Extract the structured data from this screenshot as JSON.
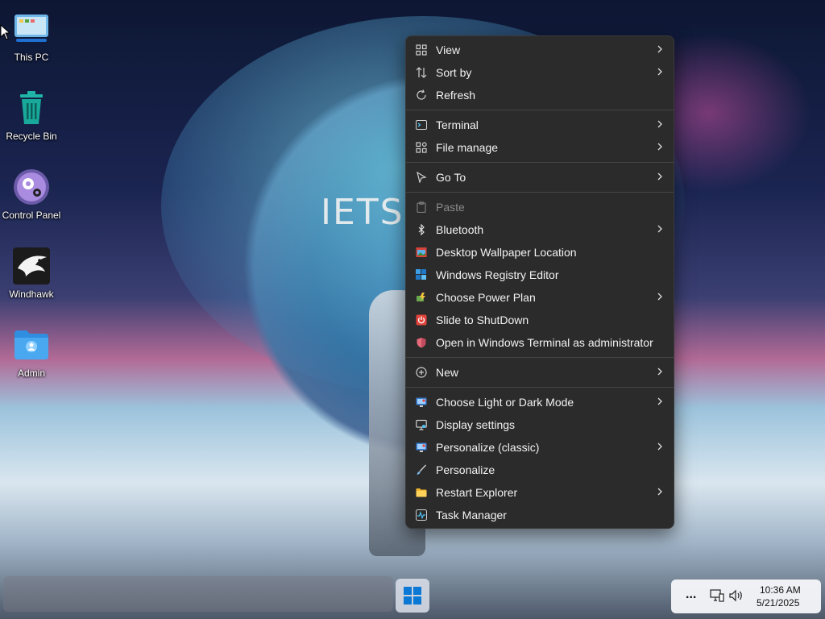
{
  "desktop": {
    "wallpaper_text": "IETS eX",
    "icons": [
      {
        "label": "This PC",
        "icon": "this-pc-icon"
      },
      {
        "label": "Recycle Bin",
        "icon": "recycle-bin-icon"
      },
      {
        "label": "Control Panel",
        "icon": "control-panel-icon"
      },
      {
        "label": "Windhawk",
        "icon": "windhawk-icon"
      },
      {
        "label": "Admin",
        "icon": "user-folder-icon"
      }
    ]
  },
  "context_menu": {
    "items": [
      {
        "label": "View",
        "icon": "grid-icon",
        "submenu": true
      },
      {
        "label": "Sort by",
        "icon": "sort-icon",
        "submenu": true
      },
      {
        "label": "Refresh",
        "icon": "refresh-icon",
        "submenu": false
      },
      {
        "label": "Terminal",
        "icon": "terminal-icon",
        "submenu": true
      },
      {
        "label": "File manage",
        "icon": "apps-icon",
        "submenu": true
      },
      {
        "label": "Go To",
        "icon": "pointer-icon",
        "submenu": true
      },
      {
        "label": "Paste",
        "icon": "clipboard-icon",
        "submenu": false,
        "disabled": true
      },
      {
        "label": "Bluetooth",
        "icon": "bluetooth-icon",
        "submenu": true
      },
      {
        "label": "Desktop Wallpaper Location",
        "icon": "wallpaper-icon",
        "submenu": false
      },
      {
        "label": "Windows Registry Editor",
        "icon": "registry-icon",
        "submenu": false
      },
      {
        "label": "Choose Power Plan",
        "icon": "power-plan-icon",
        "submenu": true
      },
      {
        "label": "Slide to ShutDown",
        "icon": "shutdown-icon",
        "submenu": false
      },
      {
        "label": "Open in Windows Terminal as administrator",
        "icon": "shield-icon",
        "submenu": false
      },
      {
        "label": "New",
        "icon": "plus-circle-icon",
        "submenu": true
      },
      {
        "label": "Choose Light or Dark Mode",
        "icon": "theme-icon",
        "submenu": true
      },
      {
        "label": "Display settings",
        "icon": "display-icon",
        "submenu": false
      },
      {
        "label": "Personalize (classic)",
        "icon": "personalize-classic-icon",
        "submenu": true
      },
      {
        "label": "Personalize",
        "icon": "brush-icon",
        "submenu": false
      },
      {
        "label": "Restart Explorer",
        "icon": "folder-icon",
        "submenu": true
      },
      {
        "label": "Task Manager",
        "icon": "task-manager-icon",
        "submenu": false
      }
    ]
  },
  "taskbar": {
    "time": "10:36 AM",
    "date": "5/21/2025",
    "overflow_label": "..."
  },
  "colors": {
    "menu_bg": "#2b2b2b",
    "menu_text": "#f2f2f2",
    "disabled_text": "#8a8a8a",
    "windows_blue": "#0a78d4"
  }
}
